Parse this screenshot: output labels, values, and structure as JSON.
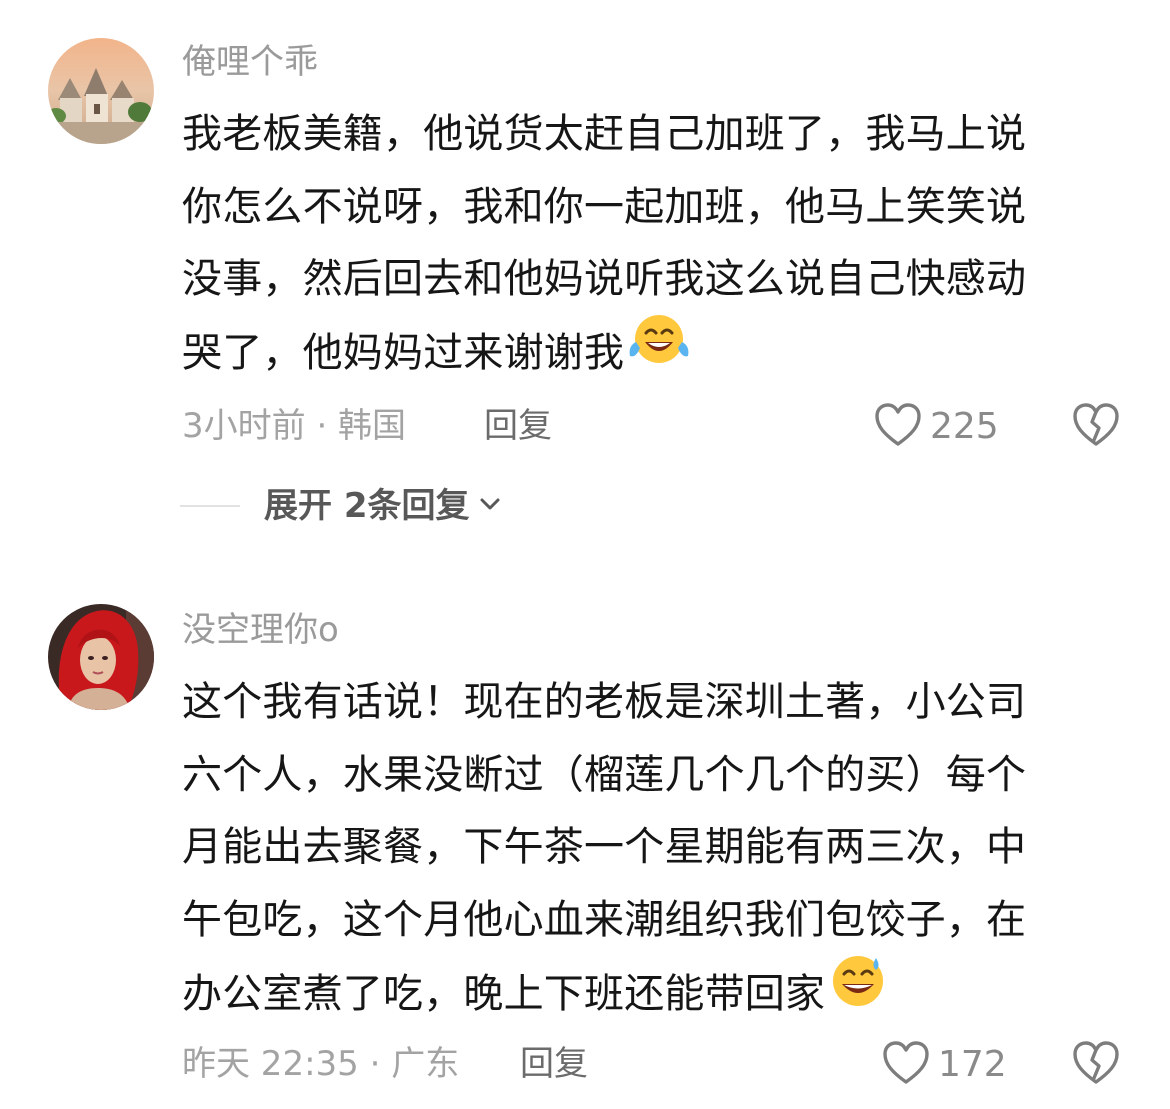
{
  "comments": [
    {
      "username": "俺哩个乖",
      "content_lines": [
        "我老板美籍，他说货太赶自己加班了，我马上说",
        "你怎么不说呀，我和你一起加班，他马上笑笑说",
        "没事，然后回去和他妈说听我这么说自己快感动",
        "哭了，他妈妈过来谢谢我"
      ],
      "emoji": "laughing-tears-emoji",
      "meta": "3小时前 · 韩国",
      "reply_label": "回复",
      "likes": "225",
      "expand_label": "展开 2条回复"
    },
    {
      "username": "没空理你o",
      "content_lines": [
        "这个我有话说！现在的老板是深圳土著，小公司",
        "六个人，水果没断过（榴莲几个几个的买）每个",
        "月能出去聚餐，下午茶一个星期能有两三次，中",
        "午包吃，这个月他心血来潮组织我们包饺子，在",
        "办公室煮了吃，晚上下班还能带回家"
      ],
      "emoji": "grinning-sweat-emoji",
      "meta": "昨天 22:35 · 广东",
      "reply_label": "回复",
      "likes": "172"
    }
  ],
  "colors": {
    "username": "#9a9a9a",
    "content": "#161616",
    "meta": "#a3a3a3",
    "emoji_face": "#ffc83d"
  },
  "icons": {
    "like": "heart-outline-icon",
    "dislike": "broken-heart-icon",
    "expand": "chevron-down-icon"
  }
}
